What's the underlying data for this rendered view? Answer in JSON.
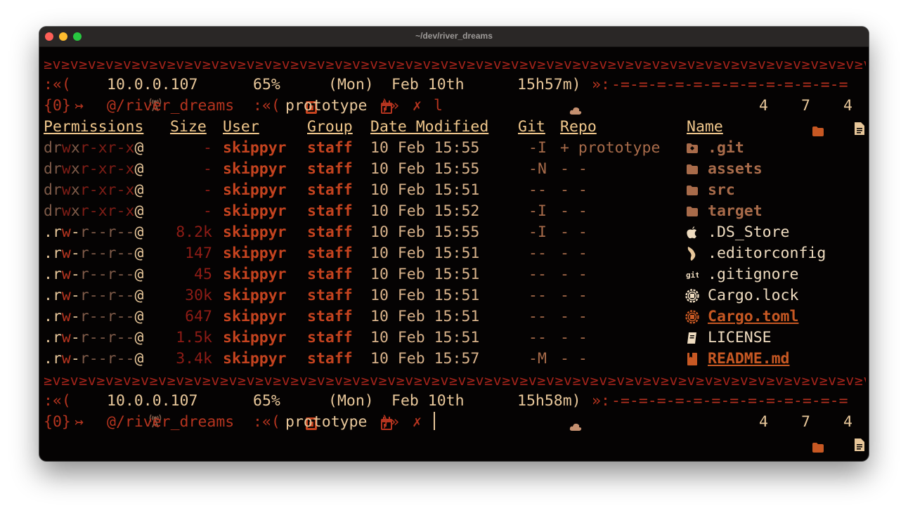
{
  "window": {
    "title": "~/dev/river_dreams"
  },
  "wave": "≥v≥v≥v≥v≥v≥v≥v≥v≥v≥v≥v≥v≥v≥v≥v≥v≥v≥v≥v≥v≥v≥v≥v≥v≥v≥v≥v≥v≥v≥v≥v≥v≥v≥v≥v≥v≥v≥v≥v≥v≥v≥v≥v≥v≥v≥v≥v≥v≥v≥v≥v≥v≥v≥v≥v≥v",
  "prompt1": {
    "open": ":«(",
    "ip": "10.0.0.107",
    "battery": "65%",
    "day": "(Mon)",
    "date": "Feb 10th",
    "time": "15h57m)",
    "close": "»:",
    "dashes": "-=-=-=-=-=-=-=-=-=-=-=-=-="
  },
  "prompt2": {
    "status": "{0}",
    "arrow": "↣",
    "path": "@/river_dreams",
    "branch_open": ":«(",
    "branch": "prototype",
    "branch_close": ")»",
    "x": "✗",
    "command": "l",
    "dirs": "4",
    "files": "7",
    "hidden": "4"
  },
  "table": {
    "headers": {
      "permissions": "Permissions",
      "size": "Size",
      "user": "User",
      "group": "Group",
      "date": "Date Modified",
      "git": "Git",
      "repo": "Repo",
      "name": "Name"
    },
    "rows": [
      {
        "perm_type": "d",
        "perm_r": "r",
        "perm_w": "w",
        "perm_x": "x",
        "perm_rest": "r-xr-x",
        "at": "@",
        "size": "-",
        "user": "skippyr",
        "group": "staff",
        "date": "10 Feb 15:55",
        "git": "-I",
        "repo": "+ prototype",
        "icon": "git-folder-icon",
        "name": ".git"
      },
      {
        "perm_type": "d",
        "perm_r": "r",
        "perm_w": "w",
        "perm_x": "x",
        "perm_rest": "r-xr-x",
        "at": "@",
        "size": "-",
        "user": "skippyr",
        "group": "staff",
        "date": "10 Feb 15:55",
        "git": "-N",
        "repo": "- -",
        "icon": "folder-icon",
        "name": "assets"
      },
      {
        "perm_type": "d",
        "perm_r": "r",
        "perm_w": "w",
        "perm_x": "x",
        "perm_rest": "r-xr-x",
        "at": "@",
        "size": "-",
        "user": "skippyr",
        "group": "staff",
        "date": "10 Feb 15:51",
        "git": "--",
        "repo": "- -",
        "icon": "folder-icon",
        "name": "src"
      },
      {
        "perm_type": "d",
        "perm_r": "r",
        "perm_w": "w",
        "perm_x": "x",
        "perm_rest": "r-xr-x",
        "at": "@",
        "size": "-",
        "user": "skippyr",
        "group": "staff",
        "date": "10 Feb 15:52",
        "git": "-I",
        "repo": "- -",
        "icon": "folder-icon",
        "name": "target"
      },
      {
        "perm_type": ".",
        "perm_r": "r",
        "perm_w": "w",
        "perm_x": "-",
        "perm_rest": "r--r--",
        "at": "@",
        "size": "8.2k",
        "user": "skippyr",
        "group": "staff",
        "date": "10 Feb 15:55",
        "git": "-I",
        "repo": "- -",
        "icon": "apple-icon",
        "name": ".DS_Store"
      },
      {
        "perm_type": ".",
        "perm_r": "r",
        "perm_w": "w",
        "perm_x": "-",
        "perm_rest": "r--r--",
        "at": "@",
        "size": "147",
        "user": "skippyr",
        "group": "staff",
        "date": "10 Feb 15:51",
        "git": "--",
        "repo": "- -",
        "icon": "editorconfig-icon",
        "name": ".editorconfig"
      },
      {
        "perm_type": ".",
        "perm_r": "r",
        "perm_w": "w",
        "perm_x": "-",
        "perm_rest": "r--r--",
        "at": "@",
        "size": "45",
        "user": "skippyr",
        "group": "staff",
        "date": "10 Feb 15:51",
        "git": "--",
        "repo": "- -",
        "icon": "git-icon",
        "name": ".gitignore"
      },
      {
        "perm_type": ".",
        "perm_r": "r",
        "perm_w": "w",
        "perm_x": "-",
        "perm_rest": "r--r--",
        "at": "@",
        "size": "30k",
        "user": "skippyr",
        "group": "staff",
        "date": "10 Feb 15:51",
        "git": "--",
        "repo": "- -",
        "icon": "rust-icon",
        "name": "Cargo.lock"
      },
      {
        "perm_type": ".",
        "perm_r": "r",
        "perm_w": "w",
        "perm_x": "-",
        "perm_rest": "r--r--",
        "at": "@",
        "size": "647",
        "user": "skippyr",
        "group": "staff",
        "date": "10 Feb 15:51",
        "git": "--",
        "repo": "- -",
        "icon": "rust-icon",
        "name": "Cargo.toml"
      },
      {
        "perm_type": ".",
        "perm_r": "r",
        "perm_w": "w",
        "perm_x": "-",
        "perm_rest": "r--r--",
        "at": "@",
        "size": "1.5k",
        "user": "skippyr",
        "group": "staff",
        "date": "10 Feb 15:51",
        "git": "--",
        "repo": "- -",
        "icon": "license-icon",
        "name": "LICENSE"
      },
      {
        "perm_type": ".",
        "perm_r": "r",
        "perm_w": "w",
        "perm_x": "-",
        "perm_rest": "r--r--",
        "at": "@",
        "size": "3.4k",
        "user": "skippyr",
        "group": "staff",
        "date": "10 Feb 15:57",
        "git": "-M",
        "repo": "- -",
        "icon": "readme-icon",
        "name": "README.md"
      }
    ]
  },
  "prompt3": {
    "open": ":«(",
    "ip": "10.0.0.107",
    "battery": "65%",
    "day": "(Mon)",
    "date": "Feb 10th",
    "time": "15h58m)",
    "close": "»:",
    "dashes": "-=-=-=-=-=-=-=-=-=-=-=-=-="
  },
  "prompt4": {
    "status": "{0}",
    "arrow": "↣",
    "path": "@/river_dreams",
    "branch_open": ":«(",
    "branch": "prototype",
    "branch_close": ")»",
    "x": "✗",
    "dirs": "4",
    "files": "7",
    "hidden": "4"
  }
}
